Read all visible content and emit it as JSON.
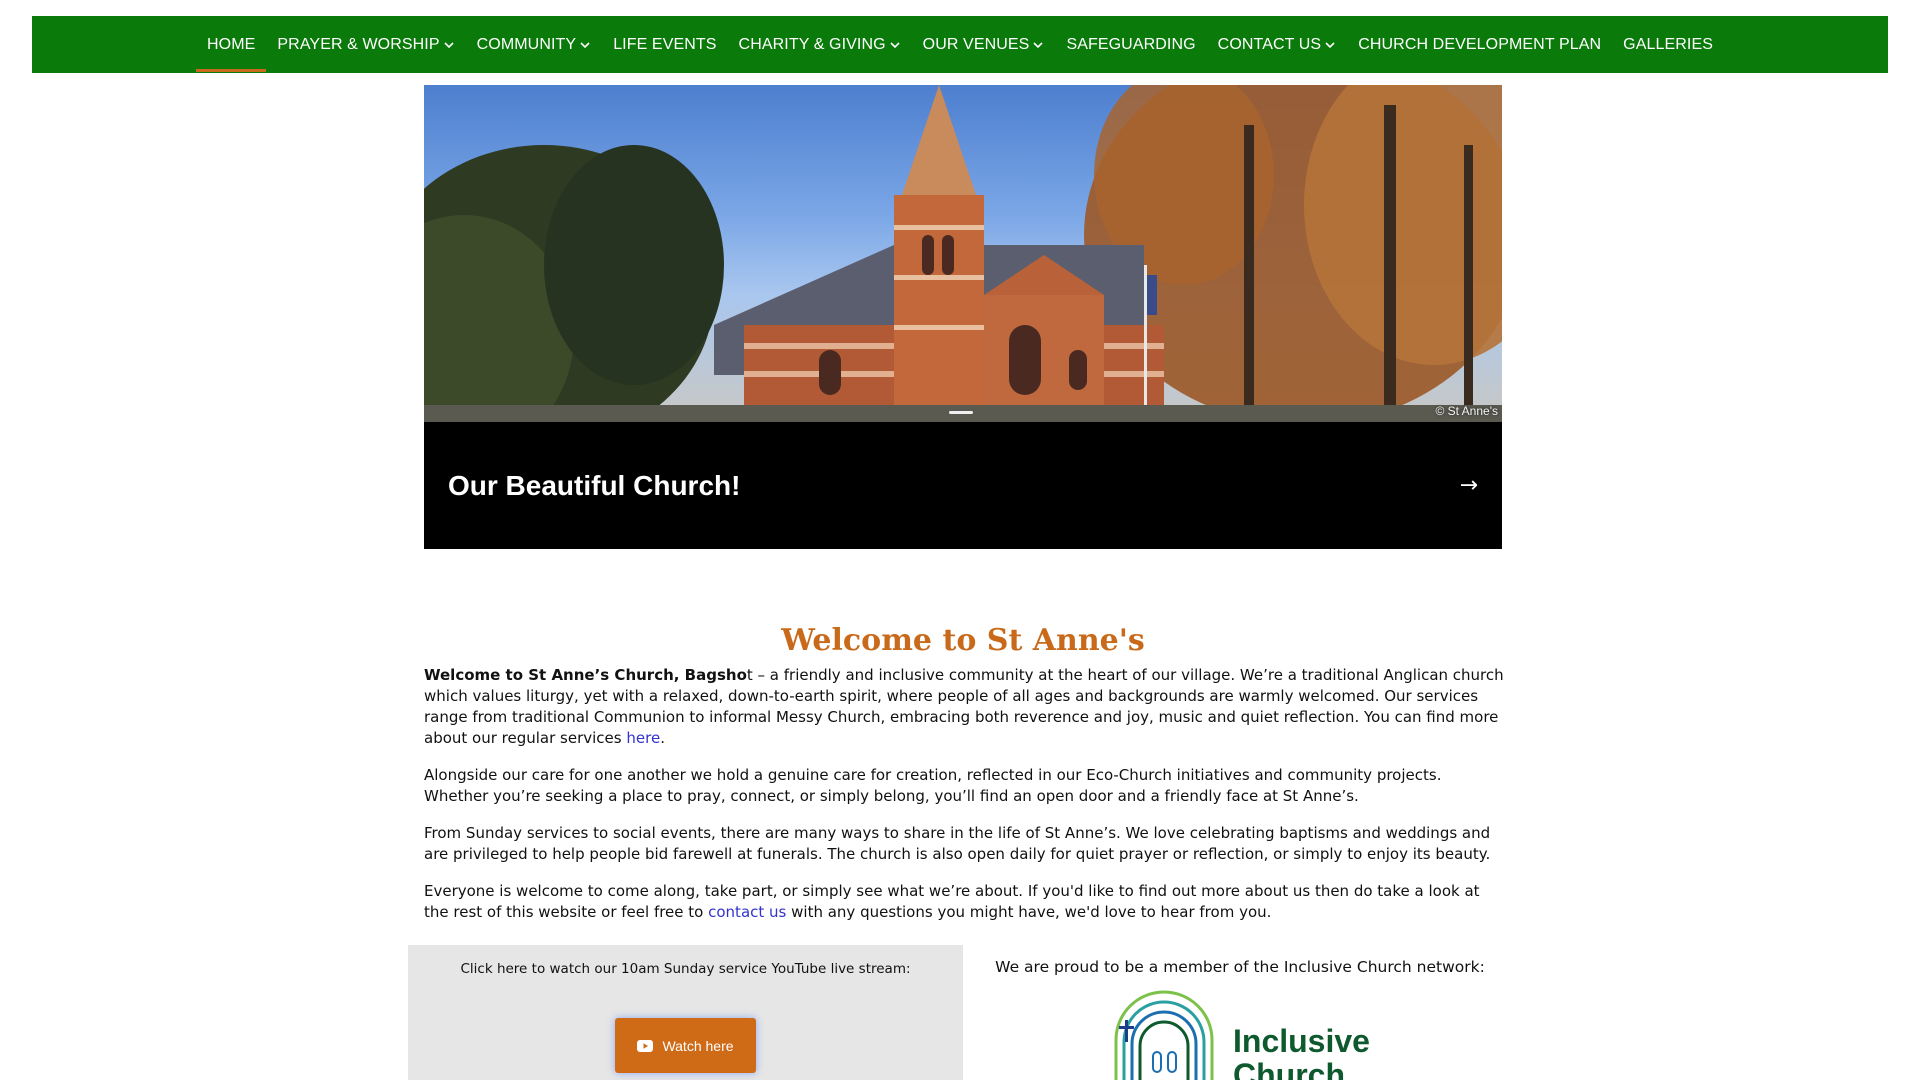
{
  "nav": {
    "items": [
      {
        "label": "HOME",
        "active": true,
        "dropdown": false
      },
      {
        "label": "PRAYER & WORSHIP",
        "active": false,
        "dropdown": true
      },
      {
        "label": "COMMUNITY",
        "active": false,
        "dropdown": true
      },
      {
        "label": "LIFE EVENTS",
        "active": false,
        "dropdown": false
      },
      {
        "label": "CHARITY & GIVING",
        "active": false,
        "dropdown": true
      },
      {
        "label": "OUR VENUES",
        "active": false,
        "dropdown": true
      },
      {
        "label": "SAFEGUARDING",
        "active": false,
        "dropdown": false
      },
      {
        "label": "CONTACT US",
        "active": false,
        "dropdown": true
      },
      {
        "label": "CHURCH DEVELOPMENT PLAN",
        "active": false,
        "dropdown": false
      },
      {
        "label": "GALLERIES",
        "active": false,
        "dropdown": false
      }
    ]
  },
  "hero": {
    "credit": "© St Anne's",
    "title": "Our Beautiful Church!",
    "arrow": "→"
  },
  "welcome": {
    "title": "Welcome to St Anne's",
    "p1_bold": "Welcome to St Anne’s Church, Bagsho",
    "p1_rest": "t – a friendly and inclusive community at the heart of our village. We’re a traditional Anglican church which values liturgy, yet with a relaxed, down-to-earth spirit, where people of all ages and backgrounds are warmly welcomed. Our services range from traditional Communion to informal Messy Church, embracing both reverence and joy, music and quiet reflection. You can find more about our regular services ",
    "p1_link": "here",
    "p1_end": ".",
    "p2": "Alongside our care for one another we hold a genuine care for creation, reflected in our Eco-Church initiatives and community projects. Whether you’re seeking a place to pray, connect, or simply belong, you’ll find an open door and a friendly face at St Anne’s.",
    "p3": "From Sunday services to social events, there are many ways to share in the life of St Anne’s. We love celebrating baptisms and weddings and are privileged to help people bid farewell at funerals. The church is also open daily for quiet prayer or reflection, or simply to enjoy its beauty.",
    "p4_start": "Everyone is welcome to come along, take part, or simply see what we’re about. If you'd like to find out more about us then do take a look at the rest of this website or feel free to ",
    "p4_link": "contact us",
    "p4_end": " with any questions you might have, we'd love to hear from you."
  },
  "stream": {
    "text": "Click here to watch our 10am Sunday service YouTube live stream:",
    "button_label": "Watch here"
  },
  "inclusive": {
    "text": "We are proud to be a member of the Inclusive Church network:",
    "logo_text_line1": "Inclusive",
    "logo_text_line2": "Church"
  },
  "colors": {
    "nav_bg": "#0a7a0a",
    "accent": "#c96a1a",
    "link": "#3333cc",
    "logo_green": "#0e5a2e"
  }
}
